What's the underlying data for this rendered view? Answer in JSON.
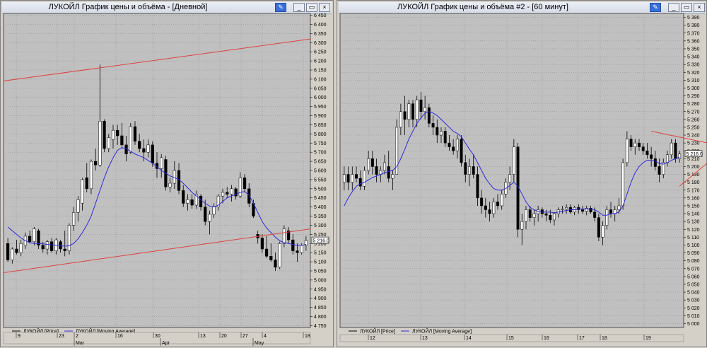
{
  "windows": [
    {
      "title": "ЛУКОЙЛ График цены и объёма - [Дневной]",
      "buttons": [
        "pin",
        "minimize",
        "maximize",
        "close"
      ]
    },
    {
      "title": "ЛУКОЙЛ График цены и объёма #2 - [60 минут]",
      "buttons": [
        "pin",
        "minimize",
        "maximize",
        "close"
      ]
    }
  ],
  "chart_data": [
    {
      "type": "candlestick",
      "title": "ЛУКОЙЛ График цены и объёма - [Дневной]",
      "ylim": [
        4740,
        6460
      ],
      "yticks": [
        6450,
        6400,
        6350,
        6300,
        6250,
        6200,
        6150,
        6100,
        6050,
        6000,
        5950,
        5900,
        5850,
        5800,
        5750,
        5700,
        5650,
        5600,
        5550,
        5500,
        5450,
        5400,
        5350,
        5300,
        5250,
        5200,
        5150,
        5100,
        5050,
        5000,
        4950,
        4900,
        4850,
        4800,
        4750
      ],
      "last_value": "5 216.0",
      "x_day_labels": [
        "9",
        "23",
        "2",
        "16",
        "30",
        "13",
        "20",
        "27",
        "4",
        "18"
      ],
      "x_month_labels": [
        "Mar",
        "Apr",
        "May"
      ],
      "legend": [
        "ЛУКОЙЛ [Price]",
        "ЛУКОЙЛ [Moving Average]"
      ],
      "grid": true,
      "trendlines": [
        {
          "from": [
            0,
            6090
          ],
          "to": [
            69,
            6320
          ]
        },
        {
          "from": [
            0,
            5040
          ],
          "to": [
            69,
            5280
          ]
        }
      ],
      "candles": [
        [
          5200,
          5230,
          5100,
          5110
        ],
        [
          5110,
          5180,
          5090,
          5170
        ],
        [
          5170,
          5220,
          5140,
          5150
        ],
        [
          5150,
          5220,
          5130,
          5200
        ],
        [
          5190,
          5260,
          5170,
          5240
        ],
        [
          5240,
          5270,
          5200,
          5210
        ],
        [
          5210,
          5290,
          5190,
          5280
        ],
        [
          5270,
          5280,
          5170,
          5190
        ],
        [
          5190,
          5210,
          5150,
          5170
        ],
        [
          5170,
          5220,
          5140,
          5210
        ],
        [
          5210,
          5230,
          5150,
          5160
        ],
        [
          5160,
          5230,
          5140,
          5220
        ],
        [
          5210,
          5220,
          5150,
          5170
        ],
        [
          5170,
          5270,
          5130,
          5160
        ],
        [
          5160,
          5310,
          5140,
          5300
        ],
        [
          5300,
          5400,
          5270,
          5370
        ],
        [
          5370,
          5460,
          5320,
          5440
        ],
        [
          5420,
          5560,
          5380,
          5550
        ],
        [
          5560,
          5640,
          5480,
          5500
        ],
        [
          5500,
          5660,
          5470,
          5650
        ],
        [
          5650,
          5720,
          5600,
          5630
        ],
        [
          5630,
          6180,
          5620,
          5870
        ],
        [
          5870,
          5880,
          5700,
          5720
        ],
        [
          5720,
          5800,
          5700,
          5780
        ],
        [
          5770,
          5850,
          5720,
          5820
        ],
        [
          5820,
          5850,
          5740,
          5790
        ],
        [
          5790,
          5860,
          5720,
          5740
        ],
        [
          5740,
          5790,
          5650,
          5690
        ],
        [
          5700,
          5860,
          5690,
          5840
        ],
        [
          5840,
          5870,
          5740,
          5760
        ],
        [
          5760,
          5800,
          5700,
          5720
        ],
        [
          5720,
          5770,
          5650,
          5700
        ],
        [
          5700,
          5770,
          5670,
          5740
        ],
        [
          5740,
          5760,
          5620,
          5640
        ],
        [
          5640,
          5700,
          5560,
          5610
        ],
        [
          5610,
          5690,
          5560,
          5670
        ],
        [
          5660,
          5680,
          5490,
          5510
        ],
        [
          5510,
          5560,
          5480,
          5530
        ],
        [
          5530,
          5650,
          5500,
          5600
        ],
        [
          5600,
          5640,
          5470,
          5490
        ],
        [
          5490,
          5520,
          5400,
          5420
        ],
        [
          5420,
          5470,
          5380,
          5440
        ],
        [
          5440,
          5470,
          5390,
          5410
        ],
        [
          5410,
          5490,
          5390,
          5470
        ],
        [
          5460,
          5470,
          5380,
          5400
        ],
        [
          5400,
          5440,
          5300,
          5320
        ],
        [
          5320,
          5380,
          5250,
          5360
        ],
        [
          5360,
          5420,
          5340,
          5400
        ],
        [
          5400,
          5470,
          5380,
          5460
        ],
        [
          5460,
          5500,
          5420,
          5480
        ],
        [
          5480,
          5510,
          5450,
          5470
        ],
        [
          5470,
          5520,
          5430,
          5500
        ],
        [
          5500,
          5510,
          5440,
          5460
        ],
        [
          5460,
          5590,
          5450,
          5560
        ],
        [
          5560,
          5580,
          5480,
          5500
        ],
        [
          5500,
          5530,
          5400,
          5420
        ],
        [
          5420,
          5440,
          5340,
          5350
        ],
        [
          5250,
          5270,
          5200,
          5230
        ],
        [
          5230,
          5250,
          5150,
          5170
        ],
        [
          5170,
          5240,
          5120,
          5130
        ],
        [
          5130,
          5200,
          5100,
          5110
        ],
        [
          5110,
          5150,
          5050,
          5070
        ],
        [
          5070,
          5210,
          5060,
          5200
        ],
        [
          5200,
          5300,
          5180,
          5280
        ],
        [
          5270,
          5290,
          5200,
          5220
        ],
        [
          5220,
          5250,
          5140,
          5160
        ],
        [
          5160,
          5200,
          5100,
          5150
        ],
        [
          5150,
          5200,
          5140,
          5190
        ],
        [
          5190,
          5240,
          5160,
          5216
        ]
      ],
      "moving_average": [
        5290,
        5270,
        5250,
        5230,
        5215,
        5205,
        5200,
        5200,
        5198,
        5195,
        5193,
        5190,
        5188,
        5185,
        5188,
        5200,
        5225,
        5260,
        5300,
        5350,
        5420,
        5490,
        5560,
        5620,
        5670,
        5710,
        5725,
        5720,
        5705,
        5690,
        5680,
        5670,
        5655,
        5640,
        5620,
        5600,
        5585,
        5570,
        5560,
        5550,
        5530,
        5505,
        5480,
        5460,
        5440,
        5420,
        5405,
        5400,
        5410,
        5430,
        5450,
        5460,
        5470,
        5480,
        5485,
        5465,
        5420,
        5370,
        5320,
        5285,
        5260,
        5235,
        5215,
        5205,
        5200,
        5195,
        5190,
        5190,
        5195
      ]
    },
    {
      "type": "candlestick",
      "title": "ЛУКОЙЛ График цены и объёма #2 - [60 минут]",
      "ylim": [
        4995,
        5395
      ],
      "yticks": [
        5390,
        5380,
        5370,
        5360,
        5350,
        5340,
        5330,
        5320,
        5310,
        5300,
        5290,
        5280,
        5270,
        5260,
        5250,
        5240,
        5230,
        5220,
        5210,
        5200,
        5190,
        5180,
        5170,
        5160,
        5150,
        5140,
        5130,
        5120,
        5110,
        5100,
        5090,
        5080,
        5070,
        5060,
        5050,
        5040,
        5030,
        5020,
        5010,
        5000
      ],
      "last_value": "5 216.0",
      "x_day_labels": [
        "12",
        "13",
        "14",
        "15",
        "16",
        "17",
        "18",
        "19"
      ],
      "legend": [
        "ЛУКОЙЛ [Price]",
        "ЛУКОЙЛ [Moving Average]"
      ],
      "grid": true,
      "trendlines": [
        {
          "from": [
            76,
            5245
          ],
          "to": [
            90,
            5230
          ]
        },
        {
          "from": [
            83,
            5175
          ],
          "to": [
            90,
            5205
          ]
        }
      ],
      "candles": [
        [
          5180,
          5200,
          5170,
          5190
        ],
        [
          5190,
          5200,
          5170,
          5180
        ],
        [
          5180,
          5200,
          5170,
          5190
        ],
        [
          5190,
          5200,
          5180,
          5185
        ],
        [
          5185,
          5195,
          5170,
          5175
        ],
        [
          5175,
          5200,
          5170,
          5195
        ],
        [
          5195,
          5220,
          5190,
          5210
        ],
        [
          5210,
          5220,
          5190,
          5200
        ],
        [
          5200,
          5210,
          5180,
          5190
        ],
        [
          5190,
          5200,
          5180,
          5195
        ],
        [
          5195,
          5215,
          5190,
          5205
        ],
        [
          5200,
          5220,
          5180,
          5185
        ],
        [
          5185,
          5195,
          5170,
          5190
        ],
        [
          5190,
          5260,
          5190,
          5250
        ],
        [
          5250,
          5280,
          5240,
          5270
        ],
        [
          5270,
          5290,
          5240,
          5260
        ],
        [
          5260,
          5285,
          5250,
          5280
        ],
        [
          5280,
          5285,
          5250,
          5260
        ],
        [
          5260,
          5290,
          5250,
          5285
        ],
        [
          5285,
          5295,
          5260,
          5270
        ],
        [
          5270,
          5290,
          5260,
          5275
        ],
        [
          5275,
          5280,
          5250,
          5255
        ],
        [
          5255,
          5265,
          5240,
          5250
        ],
        [
          5250,
          5260,
          5230,
          5240
        ],
        [
          5240,
          5250,
          5230,
          5245
        ],
        [
          5245,
          5250,
          5225,
          5230
        ],
        [
          5230,
          5240,
          5220,
          5225
        ],
        [
          5225,
          5235,
          5215,
          5220
        ],
        [
          5220,
          5240,
          5210,
          5235
        ],
        [
          5235,
          5240,
          5200,
          5205
        ],
        [
          5205,
          5215,
          5180,
          5190
        ],
        [
          5190,
          5210,
          5175,
          5200
        ],
        [
          5200,
          5215,
          5185,
          5190
        ],
        [
          5190,
          5200,
          5150,
          5160
        ],
        [
          5160,
          5170,
          5140,
          5150
        ],
        [
          5150,
          5160,
          5135,
          5145
        ],
        [
          5145,
          5155,
          5130,
          5140
        ],
        [
          5140,
          5160,
          5135,
          5155
        ],
        [
          5155,
          5165,
          5145,
          5150
        ],
        [
          5150,
          5170,
          5145,
          5165
        ],
        [
          5165,
          5185,
          5160,
          5180
        ],
        [
          5180,
          5200,
          5170,
          5190
        ],
        [
          5190,
          5235,
          5180,
          5225
        ],
        [
          5225,
          5230,
          5110,
          5120
        ],
        [
          5120,
          5140,
          5100,
          5130
        ],
        [
          5130,
          5150,
          5120,
          5145
        ],
        [
          5145,
          5150,
          5130,
          5135
        ],
        [
          5135,
          5145,
          5125,
          5140
        ],
        [
          5140,
          5150,
          5130,
          5145
        ],
        [
          5145,
          5148,
          5135,
          5140
        ],
        [
          5140,
          5145,
          5130,
          5138
        ],
        [
          5138,
          5145,
          5128,
          5132
        ],
        [
          5132,
          5142,
          5125,
          5140
        ],
        [
          5140,
          5148,
          5135,
          5145
        ],
        [
          5145,
          5150,
          5140,
          5146
        ],
        [
          5146,
          5152,
          5140,
          5148
        ],
        [
          5148,
          5152,
          5140,
          5142
        ],
        [
          5142,
          5150,
          5138,
          5148
        ],
        [
          5148,
          5152,
          5140,
          5145
        ],
        [
          5145,
          5150,
          5140,
          5143
        ],
        [
          5143,
          5150,
          5138,
          5147
        ],
        [
          5147,
          5150,
          5140,
          5142
        ],
        [
          5142,
          5148,
          5130,
          5135
        ],
        [
          5135,
          5140,
          5105,
          5110
        ],
        [
          5110,
          5130,
          5100,
          5125
        ],
        [
          5125,
          5150,
          5120,
          5145
        ],
        [
          5145,
          5155,
          5135,
          5140
        ],
        [
          5140,
          5150,
          5130,
          5145
        ],
        [
          5145,
          5160,
          5140,
          5150
        ],
        [
          5150,
          5210,
          5145,
          5205
        ],
        [
          5205,
          5245,
          5200,
          5235
        ],
        [
          5235,
          5240,
          5220,
          5225
        ],
        [
          5225,
          5235,
          5215,
          5230
        ],
        [
          5230,
          5235,
          5220,
          5225
        ],
        [
          5225,
          5230,
          5215,
          5220
        ],
        [
          5220,
          5230,
          5210,
          5215
        ],
        [
          5215,
          5225,
          5200,
          5210
        ],
        [
          5210,
          5220,
          5195,
          5200
        ],
        [
          5200,
          5210,
          5180,
          5190
        ],
        [
          5190,
          5210,
          5185,
          5205
        ],
        [
          5205,
          5220,
          5200,
          5215
        ],
        [
          5215,
          5235,
          5210,
          5230
        ],
        [
          5230,
          5235,
          5205,
          5210
        ],
        [
          5210,
          5220,
          5205,
          5216
        ]
      ],
      "moving_average": [
        5150,
        5160,
        5168,
        5175,
        5178,
        5180,
        5183,
        5186,
        5188,
        5190,
        5192,
        5194,
        5195,
        5200,
        5210,
        5222,
        5235,
        5245,
        5255,
        5262,
        5268,
        5270,
        5268,
        5265,
        5260,
        5255,
        5250,
        5245,
        5242,
        5238,
        5230,
        5222,
        5215,
        5205,
        5195,
        5185,
        5178,
        5172,
        5170,
        5170,
        5172,
        5176,
        5180,
        5175,
        5165,
        5155,
        5148,
        5145,
        5143,
        5142,
        5142,
        5142,
        5141,
        5142,
        5143,
        5144,
        5145,
        5145,
        5146,
        5146,
        5146,
        5146,
        5145,
        5142,
        5138,
        5138,
        5140,
        5140,
        5142,
        5150,
        5165,
        5180,
        5192,
        5200,
        5205,
        5208,
        5208,
        5207,
        5204,
        5203,
        5205,
        5208,
        5210,
        5212
      ]
    }
  ]
}
